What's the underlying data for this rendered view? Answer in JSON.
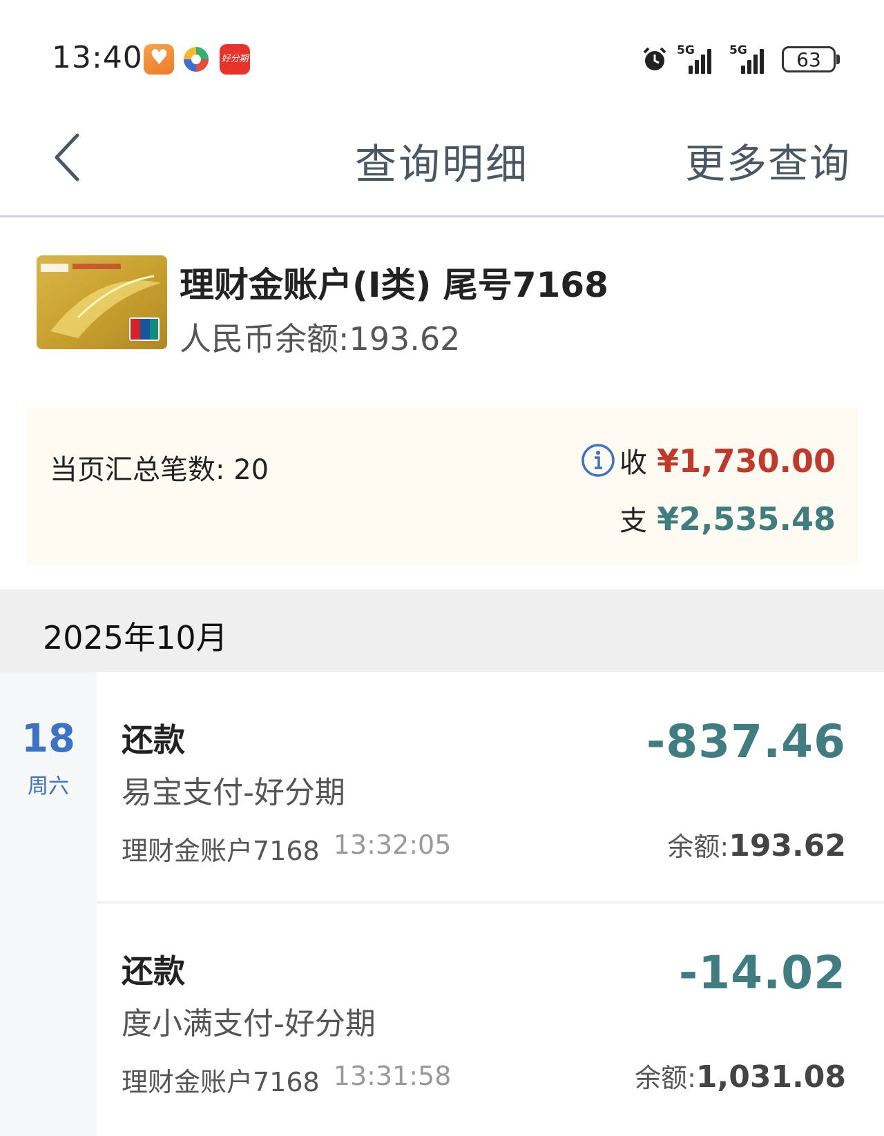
{
  "status_bar": {
    "time": "13:40",
    "app_icons": [
      "health-app-icon",
      "pinwheel-app-icon",
      "haofenqi-app-icon"
    ],
    "haofenqi_label": "好分期",
    "signal_1_tag": "5G",
    "signal_2_tag": "5G",
    "battery": "63"
  },
  "header": {
    "title": "查询明细",
    "more": "更多查询"
  },
  "account": {
    "name": "理财金账户(I类) 尾号7168",
    "balance": "人民币余额:193.62"
  },
  "summary": {
    "count_label": "当页汇总笔数: 20",
    "income_key": "收",
    "income_value": "¥1,730.00",
    "expense_key": "支",
    "expense_value": "¥2,535.48"
  },
  "month": {
    "label": "2025年10月"
  },
  "date_group": {
    "day": "18",
    "weekday": "周六"
  },
  "transactions": [
    {
      "type": "还款",
      "merchant": "易宝支付-好分期",
      "account": "理财金账户7168",
      "time": "13:32:05",
      "amount": "-837.46",
      "balance_label": "余额:",
      "balance_value": "193.62"
    },
    {
      "type": "还款",
      "merchant": "度小满支付-好分期",
      "account": "理财金账户7168",
      "time": "13:31:58",
      "amount": "-14.02",
      "balance_label": "余额:",
      "balance_value": "1,031.08"
    }
  ],
  "colors": {
    "income": "#c0392b",
    "expense": "#3f7d80",
    "date_accent": "#3c72c7"
  }
}
